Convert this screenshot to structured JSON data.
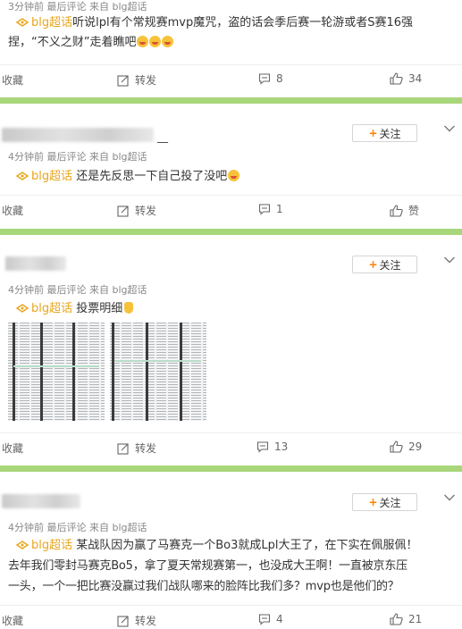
{
  "colors": {
    "topic": "#e8a61e",
    "separator": "#a8d67a",
    "follow_plus": "#ff8200"
  },
  "posts": [
    {
      "meta": "3分钟前 最后评论 来自 blg超话",
      "topic": "blg超话",
      "text": "听说lpl有个常规赛mvp魔咒，盗的话会季后赛一轮游或者S赛16强",
      "text_line2": "捏，“不义之财”走着瞧吧",
      "emojis": [
        "laughing-face",
        "laughing-face",
        "laughing-face"
      ],
      "actions": {
        "collect": "收藏",
        "repost": "转发",
        "comment": "8",
        "like": "34"
      }
    },
    {
      "author_tail": "__",
      "follow": "关注",
      "meta": "4分钟前 最后评论 来自 blg超话",
      "topic": "blg超话",
      "text": "还是先反思一下自己投了没吧",
      "emojis": [
        "crying-face"
      ],
      "actions": {
        "collect": "收藏",
        "repost": "转发",
        "comment": "1",
        "like": "赞"
      }
    },
    {
      "follow": "关注",
      "meta": "4分钟前 最后评论 来自 blg超话",
      "topic": "blg超话",
      "text": "投票明细",
      "emojis": [
        "pointing-down-hand"
      ],
      "actions": {
        "collect": "收藏",
        "repost": "转发",
        "comment": "13",
        "like": "29"
      }
    },
    {
      "follow": "关注",
      "meta": "4分钟前 最后评论 来自 blg超话",
      "topic": "blg超话",
      "text": "某战队因为赢了马赛克一个Bo3就成Lpl大王了，在下实在佩服佩！",
      "text_line2": "去年我们零封马赛克Bo5，拿了夏天常规赛第一，也没成大王啊！一直被京东压",
      "text_line3": "一头，一个一把比赛没赢过我们战队哪来的脸阵比我们多？mvp也是他们的？",
      "actions": {
        "collect": "收藏",
        "repost": "转发",
        "comment": "4",
        "like": "21"
      }
    }
  ]
}
